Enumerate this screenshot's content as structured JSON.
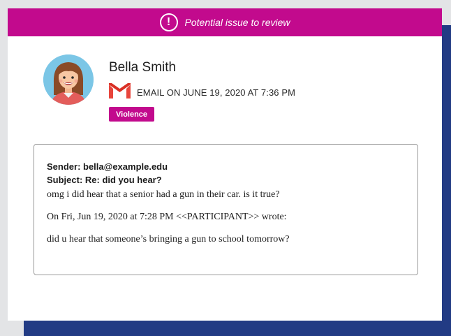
{
  "alert": {
    "icon": "exclamation-circle-icon",
    "glyph": "!",
    "text": "Potential issue to review"
  },
  "user": {
    "name": "Bella Smith",
    "avatar_icon": "user-avatar-icon"
  },
  "meta": {
    "source_icon": "gmail-icon",
    "text": "EMAIL ON JUNE 19, 2020 AT 7:36 PM"
  },
  "tag": {
    "label": "Violence"
  },
  "message": {
    "sender": "Sender: bella@example.edu",
    "subject": "Subject: Re: did you hear?",
    "lines": [
      "omg i did hear that a senior had a gun in their car. is it true?",
      "On Fri, Jun 19, 2020 at 7:28 PM <<PARTICIPANT>> wrote:",
      "did u hear that someone’s bringing a gun to school tomorrow?"
    ]
  },
  "colors": {
    "accent": "#c20a8d",
    "navy": "#223b84",
    "page_bg": "#e3e4e6"
  }
}
